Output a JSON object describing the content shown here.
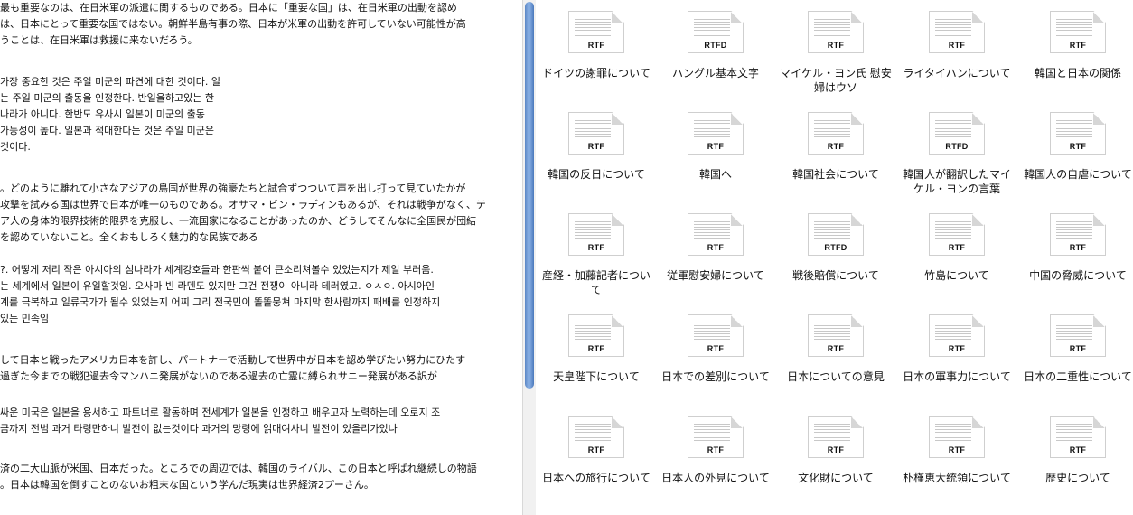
{
  "editor": {
    "paragraphs": [
      [
        "最も重要なのは、在日米軍の派遣に関するものである。日本に「重要な国」は、在日米軍の出動を認め",
        "は、日本にとって重要な国ではない。朝鮮半島有事の際、日本が米軍の出動を許可していない可能性が高",
        "うことは、在日米軍は救援に来ないだろう。"
      ],
      [
        "가장 중요한 것은 주일 미군의 파견에 대한 것이다. 일",
        "는 주일 미군의 출동을 인정한다. 반일을하고있는 한",
        " 나라가 아니다. 한반도 유사시 일본이 미군의 출동",
        "가능성이 높다. 일본과 적대한다는 것은 주일 미군은",
        "것이다."
      ],
      [
        "。どのように離れて小さなアジアの島国が世界の強豪たちと試合ずつついて声を出し打って見ていたかが",
        "攻撃を試みる国は世界で日本が唯一のものである。オサマ・ビン・ラディンもあるが、それは戦争がなく、テ",
        "ア人の身体的限界技術的限界を克服し、一流国家になることがあったのか、どうしてそんなに全国民が団結",
        "を認めていないこと。全くおもしろく魅力的な民族である"
      ],
      [
        "?. 어떻게 저리 작은 아시아의 섬나라가 세계강호들과 한판씩 붙어 큰소리쳐볼수 있었는지가 제일 부러움.",
        "는 세계에서 일본이 유일할것임. 오사마 빈 라덴도 있지만 그건 전쟁이 아니라 테러였고. ㅇㅅㅇ. 아시아인",
        "계를 극복하고 일류국가가 될수 있었는지 어찌 그리 전국민이 똘똘뭉쳐 마지막 한사람까지 패배를 인정하지",
        "있는 민족임"
      ],
      [
        "して日本と戦ったアメリカ日本を許し、パートナーで活動して世界中が日本を認め学びたい努力にひたす",
        "過ぎた今までの戦犯過去令マンハニ発展がないのである過去の亡霊に縛られサニー発展がある訳が"
      ],
      [
        "싸운 미국은 일본을 용서하고 파트너로 활동하며 전세계가 일본을 인정하고 배우고자 노력하는데 오로지 조",
        "금까지 전범 과거 타령만하니 발전이 없는것이다 과거의 망령에 얽매여사니 발전이 있을리가있나"
      ],
      [
        "済の二大山脈が米国、日本だった。ところでの周辺では、韓国のライバル、この日本と呼ばれ継続しの物語",
        "。日本は韓国を倒すことのないお粗末な国という学んだ現実は世界経済2プーさん。"
      ]
    ]
  },
  "finder": {
    "files": [
      {
        "name": "ドイツの謝罪について",
        "badge": "RTF"
      },
      {
        "name": "ハングル基本文字",
        "badge": "RTFD"
      },
      {
        "name": "マイケル・ヨン氏 慰安婦はウソ",
        "badge": "RTF"
      },
      {
        "name": "ライタイハンについて",
        "badge": "RTF"
      },
      {
        "name": "韓国と日本の関係",
        "badge": "RTF"
      },
      {
        "name": "韓国の反日について",
        "badge": "RTF"
      },
      {
        "name": "韓国へ",
        "badge": "RTF"
      },
      {
        "name": "韓国社会について",
        "badge": "RTF"
      },
      {
        "name": "韓国人が翻訳したマイケル・ヨンの言葉",
        "badge": "RTFD"
      },
      {
        "name": "韓国人の自虐について",
        "badge": "RTF"
      },
      {
        "name": "産経・加藤記者について",
        "badge": "RTF"
      },
      {
        "name": "従軍慰安婦について",
        "badge": "RTF"
      },
      {
        "name": "戦後賠償について",
        "badge": "RTFD"
      },
      {
        "name": "竹島について",
        "badge": "RTF"
      },
      {
        "name": "中国の脅威について",
        "badge": "RTF"
      },
      {
        "name": "天皇陛下について",
        "badge": "RTF"
      },
      {
        "name": "日本での差別について",
        "badge": "RTF"
      },
      {
        "name": "日本についての意見",
        "badge": "RTF"
      },
      {
        "name": "日本の軍事力について",
        "badge": "RTF"
      },
      {
        "name": "日本の二重性について",
        "badge": "RTF"
      },
      {
        "name": "日本への旅行について",
        "badge": "RTF"
      },
      {
        "name": "日本人の外見について",
        "badge": "RTF"
      },
      {
        "name": "文化財について",
        "badge": "RTF"
      },
      {
        "name": "朴槿恵大統領について",
        "badge": "RTF"
      },
      {
        "name": "歴史について",
        "badge": "RTF"
      }
    ]
  }
}
